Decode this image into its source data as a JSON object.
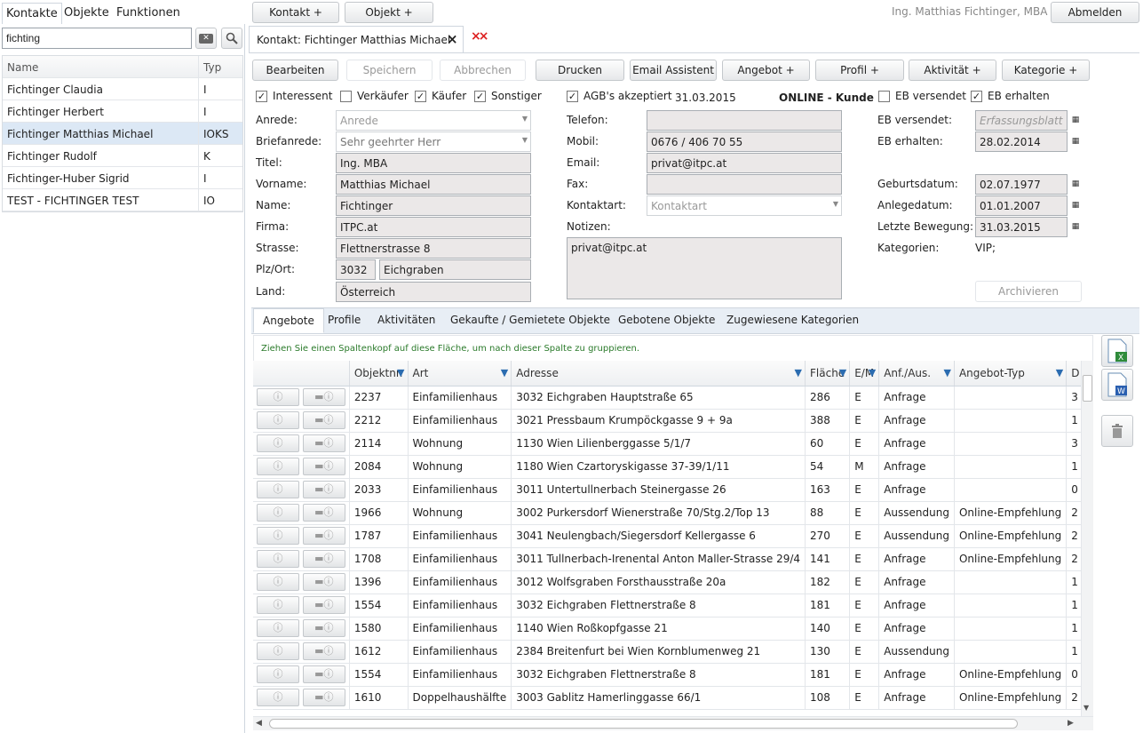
{
  "nav": {
    "tabs": [
      "Kontakte",
      "Objekte",
      "Funktionen"
    ]
  },
  "top_buttons": {
    "kontakt_plus": "Kontakt +",
    "objekt_plus": "Objekt +",
    "abmelden": "Abmelden"
  },
  "user": "Ing. Matthias Fichtinger, MBA",
  "search": {
    "value": "fichting"
  },
  "contact_list": {
    "headers": {
      "name": "Name",
      "typ": "Typ"
    },
    "rows": [
      {
        "name": "Fichtinger Claudia",
        "typ": "I"
      },
      {
        "name": "Fichtinger Herbert",
        "typ": "I"
      },
      {
        "name": "Fichtinger Matthias Michael",
        "typ": "IOKS"
      },
      {
        "name": "Fichtinger Rudolf",
        "typ": "K"
      },
      {
        "name": "Fichtinger-Huber Sigrid",
        "typ": "I"
      },
      {
        "name": "TEST - FICHTINGER TEST",
        "typ": "IO"
      }
    ],
    "selected_index": 2
  },
  "doc_tab": {
    "title": "Kontakt: Fichtinger Matthias Michael",
    "close": "×",
    "close_all": "××"
  },
  "toolbar": {
    "bearbeiten": "Bearbeiten",
    "speichern": "Speichern",
    "abbrechen": "Abbrechen",
    "drucken": "Drucken",
    "email_assistent": "Email Assistent",
    "angebot": "Angebot +",
    "profil": "Profil +",
    "aktivitaet": "Aktivität +",
    "kategorie": "Kategorie +"
  },
  "checks": {
    "interessent": "Interessent",
    "verkaeufer": "Verkäufer",
    "kaeufer": "Käufer",
    "sonstiger": "Sonstiger",
    "agb": "AGB's akzeptiert",
    "agb_date": "31.03.2015",
    "online": "ONLINE - Kunde",
    "eb_versendet": "EB versendet",
    "eb_erhalten": "EB erhalten"
  },
  "form": {
    "anrede_label": "Anrede:",
    "anrede_ph": "Anrede",
    "briefanrede_label": "Briefanrede:",
    "briefanrede": "Sehr geehrter Herr",
    "titel_label": "Titel:",
    "titel": "Ing. MBA",
    "vorname_label": "Vorname:",
    "vorname": "Matthias Michael",
    "name_label": "Name:",
    "name": "Fichtinger",
    "firma_label": "Firma:",
    "firma": "ITPC.at",
    "strasse_label": "Strasse:",
    "strasse": "Flettnerstrasse 8",
    "plz_label": "Plz/Ort:",
    "plz": "3032",
    "ort": "Eichgraben",
    "land_label": "Land:",
    "land": "Österreich",
    "telefon_label": "Telefon:",
    "telefon": "",
    "mobil_label": "Mobil:",
    "mobil": "0676 / 406 70 55",
    "email_label": "Email:",
    "email": "privat@itpc.at",
    "fax_label": "Fax:",
    "fax": "",
    "kontaktart_label": "Kontaktart:",
    "kontaktart_ph": "Kontaktart",
    "notizen_label": "Notizen:",
    "notizen": "privat@itpc.at",
    "eb_versendet_label": "EB versendet:",
    "eb_versendet_ph": "Erfassungsblatt",
    "eb_erhalten_label": "EB erhalten:",
    "eb_erhalten": "28.02.2014",
    "geburtsdatum_label": "Geburtsdatum:",
    "geburtsdatum": "02.07.1977",
    "anlegedatum_label": "Anlegedatum:",
    "anlegedatum": "01.01.2007",
    "letzte_label": "Letzte Bewegung:",
    "letzte": "31.03.2015",
    "kategorien_label": "Kategorien:",
    "kategorien": "VIP;",
    "archivieren": "Archivieren"
  },
  "bottom_tabs": [
    "Angebote",
    "Profile",
    "Aktivitäten",
    "Gekaufte / Gemietete Objekte",
    "Gebotene Objekte",
    "Zugewiesene Kategorien"
  ],
  "group_hint": "Ziehen Sie einen Spaltenkopf auf diese Fläche, um nach dieser Spalte zu gruppieren.",
  "grid": {
    "headers": [
      "Objektnr.",
      "Art",
      "Adresse",
      "Fläche",
      "E/M",
      "Anf./Aus.",
      "Angebot-Typ",
      "D"
    ],
    "rows": [
      [
        "2237",
        "Einfamilienhaus",
        "3032 Eichgraben Hauptstraße 65",
        "286",
        "E",
        "Anfrage",
        "",
        "3"
      ],
      [
        "2212",
        "Einfamilienhaus",
        "3021 Pressbaum Krumpöckgasse 9 + 9a",
        "388",
        "E",
        "Anfrage",
        "",
        "1"
      ],
      [
        "2114",
        "Wohnung",
        "1130 Wien Lilienberggasse 5/1/7",
        "60",
        "E",
        "Anfrage",
        "",
        "3"
      ],
      [
        "2084",
        "Wohnung",
        "1180 Wien Czartoryskigasse 37-39/1/11",
        "54",
        "M",
        "Anfrage",
        "",
        "1"
      ],
      [
        "2033",
        "Einfamilienhaus",
        "3011 Untertullnerbach Steinergasse 26",
        "163",
        "E",
        "Anfrage",
        "",
        "0"
      ],
      [
        "1966",
        "Wohnung",
        "3002 Purkersdorf Wienerstraße 70/Stg.2/Top 13",
        "88",
        "E",
        "Aussendung",
        "Online-Empfehlung",
        "2"
      ],
      [
        "1787",
        "Einfamilienhaus",
        "3041 Neulengbach/Siegersdorf Kellergasse 6",
        "270",
        "E",
        "Aussendung",
        "Online-Empfehlung",
        "2"
      ],
      [
        "1708",
        "Einfamilienhaus",
        "3011 Tullnerbach-Irenental Anton Maller-Strasse 29/4",
        "141",
        "E",
        "Anfrage",
        "Online-Empfehlung",
        "2"
      ],
      [
        "1396",
        "Einfamilienhaus",
        "3012 Wolfsgraben Forsthausstraße 20a",
        "182",
        "E",
        "Anfrage",
        "",
        "1"
      ],
      [
        "1554",
        "Einfamilienhaus",
        "3032 Eichgraben Flettnerstraße 8",
        "181",
        "E",
        "Anfrage",
        "",
        "1"
      ],
      [
        "1580",
        "Einfamilienhaus",
        "1140 Wien Roßkopfgasse 21",
        "140",
        "E",
        "Anfrage",
        "",
        "1"
      ],
      [
        "1612",
        "Einfamilienhaus",
        "2384 Breitenfurt bei Wien Kornblumenweg 21",
        "130",
        "E",
        "Aussendung",
        "",
        "1"
      ],
      [
        "1554",
        "Einfamilienhaus",
        "3032 Eichgraben Flettnerstraße 8",
        "181",
        "E",
        "Anfrage",
        "Online-Empfehlung",
        "0"
      ],
      [
        "1610",
        "Doppelhaushälfte",
        "3003 Gablitz Hamerlinggasse 66/1",
        "108",
        "E",
        "Anfrage",
        "Online-Empfehlung",
        "2"
      ]
    ]
  }
}
